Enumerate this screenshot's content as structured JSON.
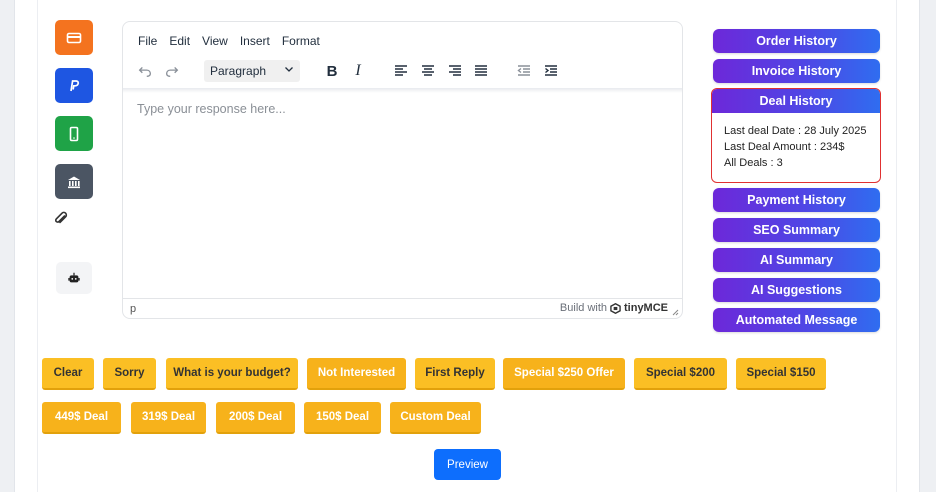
{
  "payment_icons": [
    {
      "name": "card-icon",
      "color": "#f4731f"
    },
    {
      "name": "paypal-icon",
      "color": "#1e56e2"
    },
    {
      "name": "mobile-icon",
      "color": "#1fa347"
    },
    {
      "name": "bank-icon",
      "color": "#4b5563"
    }
  ],
  "editor": {
    "menu": [
      "File",
      "Edit",
      "View",
      "Insert",
      "Format"
    ],
    "block_format": "Paragraph",
    "placeholder": "Type your response here...",
    "status_path": "p",
    "branding_prefix": "Build with",
    "branding_name": "tinyMCE"
  },
  "side_panel": {
    "buttons_top": [
      "Order History",
      "Invoice History"
    ],
    "deal_history": {
      "title": "Deal History",
      "last_deal_date": "Last deal Date : 28 July 2025",
      "last_deal_amount": "Last Deal Amount : 234$",
      "all_deals": "All Deals : 3"
    },
    "buttons_bottom": [
      "Payment History",
      "SEO Summary",
      "AI Summary",
      "AI Suggestions",
      "Automated Message"
    ]
  },
  "quick_replies_row1": [
    "Clear",
    "Sorry",
    "What is your budget?",
    "Not Interested",
    "First Reply",
    "Special $250 Offer",
    "Special $200",
    "Special $150"
  ],
  "quick_replies_row2": [
    "449$ Deal",
    "319$ Deal",
    "200$ Deal",
    "150$ Deal",
    "Custom Deal"
  ],
  "preview_label": "Preview",
  "colors": {
    "accent_purple": "#6d28d9",
    "accent_blue": "#2f6df0",
    "quick_reply": "#fbbf24",
    "preview": "#0d6efd",
    "deal_border": "#e03131"
  }
}
